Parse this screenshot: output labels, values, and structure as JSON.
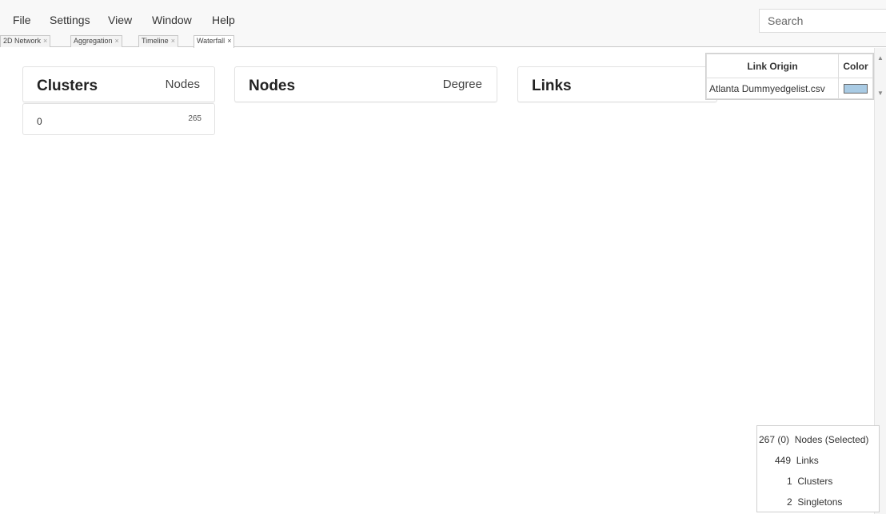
{
  "menu": [
    "File",
    "Settings",
    "View",
    "Window",
    "Help"
  ],
  "search": {
    "placeholder": "Search"
  },
  "tabs": [
    {
      "label": "2D Network",
      "close": "×"
    },
    {
      "label": "Aggregation",
      "close": "×"
    },
    {
      "label": "Timeline",
      "close": "×"
    },
    {
      "label": "Waterfall",
      "close": "×"
    }
  ],
  "panels": {
    "clusters": {
      "title": "Clusters",
      "column": "Nodes",
      "rows": [
        {
          "name": "0",
          "value": "265"
        }
      ]
    },
    "nodes": {
      "title": "Nodes",
      "column": "Degree"
    },
    "links": {
      "title": "Links"
    }
  },
  "legend": {
    "header_origin": "Link Origin",
    "header_color": "Color",
    "rows": [
      {
        "origin": "Atlanta Dummyedgelist.csv",
        "color": "#a9cbe4"
      }
    ]
  },
  "stats": {
    "nodes_count": "267 (0)",
    "nodes_label": "Nodes (Selected)",
    "links_count": "449",
    "links_label": "Links",
    "clusters_count": "1",
    "clusters_label": "Clusters",
    "singletons_count": "2",
    "singletons_label": "Singletons"
  },
  "colors": {
    "menubar_bg": "#f8f8f8",
    "border": "#e2e2e2"
  }
}
